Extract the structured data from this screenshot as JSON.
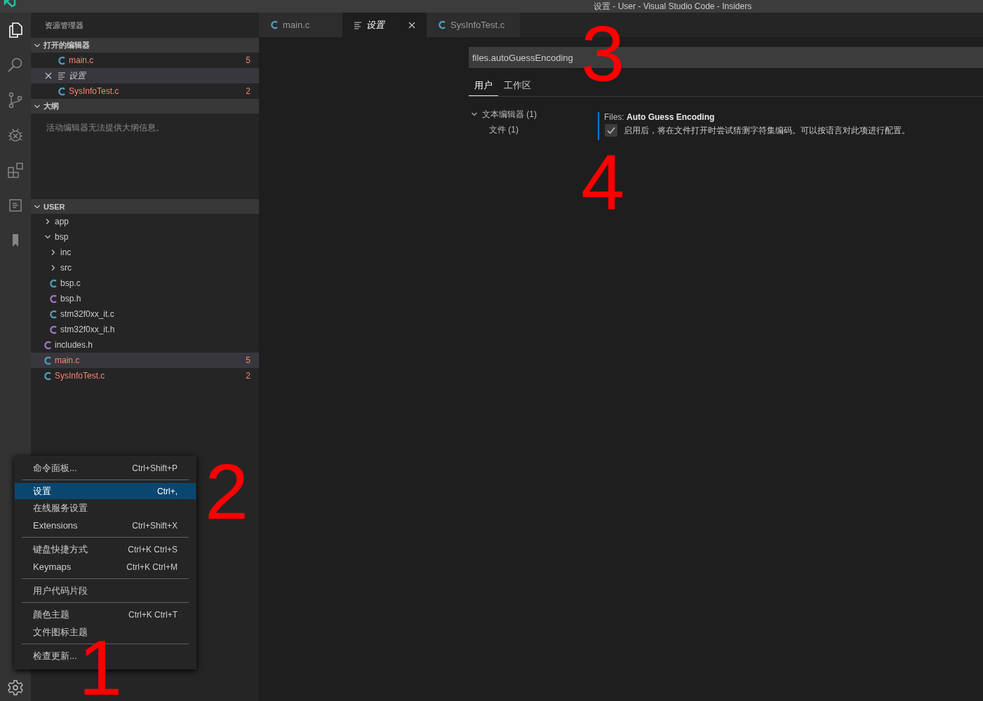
{
  "window": {
    "title": "设置 - User - Visual Studio Code - Insiders"
  },
  "activity_bar": {
    "items": [
      {
        "kind": "files",
        "selected": true
      },
      {
        "kind": "search",
        "selected": false
      },
      {
        "kind": "source-control",
        "selected": false
      },
      {
        "kind": "debug",
        "selected": false
      },
      {
        "kind": "extensions",
        "selected": false
      },
      {
        "kind": "document",
        "selected": false
      },
      {
        "kind": "bookmark",
        "selected": false
      }
    ]
  },
  "sidebar": {
    "title": "资源管理器",
    "sections": [
      {
        "kind": "open-editors",
        "title": "打开的编辑器",
        "expanded": true,
        "items": [
          {
            "label": "main.c",
            "kind": "c",
            "errors": true,
            "badge": "5",
            "selected": false,
            "preview": false
          },
          {
            "label": "设置",
            "kind": "settings",
            "errors": false,
            "selected": true,
            "preview": true
          },
          {
            "label": "SysInfoTest.c",
            "kind": "c",
            "errors": true,
            "badge": "2",
            "selected": false,
            "preview": false
          }
        ]
      },
      {
        "kind": "message",
        "title": "大纲",
        "expanded": true,
        "message": "活动编辑器无法提供大纲信息。"
      },
      {
        "kind": "tree",
        "title": "USER",
        "expanded": true,
        "children": [
          {
            "label": "app",
            "kind": "folder",
            "expanded": false,
            "errors": false,
            "selected": false
          },
          {
            "label": "bsp",
            "kind": "folder",
            "expanded": true,
            "errors": false,
            "selected": false,
            "children": [
              {
                "label": "inc",
                "kind": "folder",
                "expanded": false,
                "errors": false,
                "selected": false
              },
              {
                "label": "src",
                "kind": "folder",
                "expanded": false,
                "errors": false,
                "selected": false
              },
              {
                "label": "bsp.c",
                "kind": "c",
                "errors": false,
                "selected": false
              },
              {
                "label": "bsp.h",
                "kind": "h",
                "errors": false,
                "selected": false
              },
              {
                "label": "stm32f0xx_it.c",
                "kind": "c",
                "errors": false,
                "selected": false
              },
              {
                "label": "stm32f0xx_it.h",
                "kind": "h",
                "errors": false,
                "selected": false
              }
            ]
          },
          {
            "label": "includes.h",
            "kind": "h",
            "errors": false,
            "selected": false
          },
          {
            "label": "main.c",
            "kind": "c",
            "errors": true,
            "badge": "5",
            "selected": true
          },
          {
            "label": "SysInfoTest.c",
            "kind": "c",
            "errors": true,
            "badge": "2",
            "selected": false
          }
        ]
      }
    ]
  },
  "editor": {
    "tabs": [
      {
        "label": "main.c",
        "kind": "c",
        "selected": false,
        "preview": false
      },
      {
        "label": "设置",
        "kind": "settings",
        "selected": true,
        "preview": true
      },
      {
        "label": "SysInfoTest.c",
        "kind": "c",
        "selected": false,
        "preview": false
      }
    ],
    "settings": {
      "search": {
        "value": "files.autoGuessEncoding"
      },
      "scope_tabs": [
        {
          "label": "用户",
          "selected": true
        },
        {
          "label": "工作区",
          "selected": false
        }
      ],
      "toc": [
        {
          "label": "文本编辑器 (1)",
          "expanded": true,
          "children": [
            {
              "label": "文件 (1)"
            }
          ]
        }
      ],
      "setting": {
        "category": "Files: ",
        "title": "Auto Guess Encoding",
        "checked": true,
        "description": "启用后，将在文件打开时尝试猜测字符集编码。可以按语言对此项进行配置。"
      }
    }
  },
  "menu": {
    "groups": [
      [
        {
          "label": "命令面板...",
          "shortcut": "Ctrl+Shift+P",
          "selected": false
        }
      ],
      [
        {
          "label": "设置",
          "shortcut": "Ctrl+,",
          "selected": true
        },
        {
          "label": "在线服务设置",
          "selected": false
        },
        {
          "label": "Extensions",
          "shortcut": "Ctrl+Shift+X",
          "selected": false
        }
      ],
      [
        {
          "label": "键盘快捷方式",
          "shortcut": "Ctrl+K Ctrl+S",
          "selected": false
        },
        {
          "label": "Keymaps",
          "shortcut": "Ctrl+K Ctrl+M",
          "selected": false
        }
      ],
      [
        {
          "label": "用户代码片段",
          "selected": false
        }
      ],
      [
        {
          "label": "颜色主题",
          "shortcut": "Ctrl+K Ctrl+T",
          "selected": false
        },
        {
          "label": "文件图标主题",
          "selected": false
        }
      ],
      [
        {
          "label": "检查更新...",
          "selected": false
        }
      ]
    ]
  },
  "annotations": [
    {
      "text": "3"
    },
    {
      "text": "4"
    },
    {
      "text": "2"
    },
    {
      "text": "1"
    }
  ]
}
